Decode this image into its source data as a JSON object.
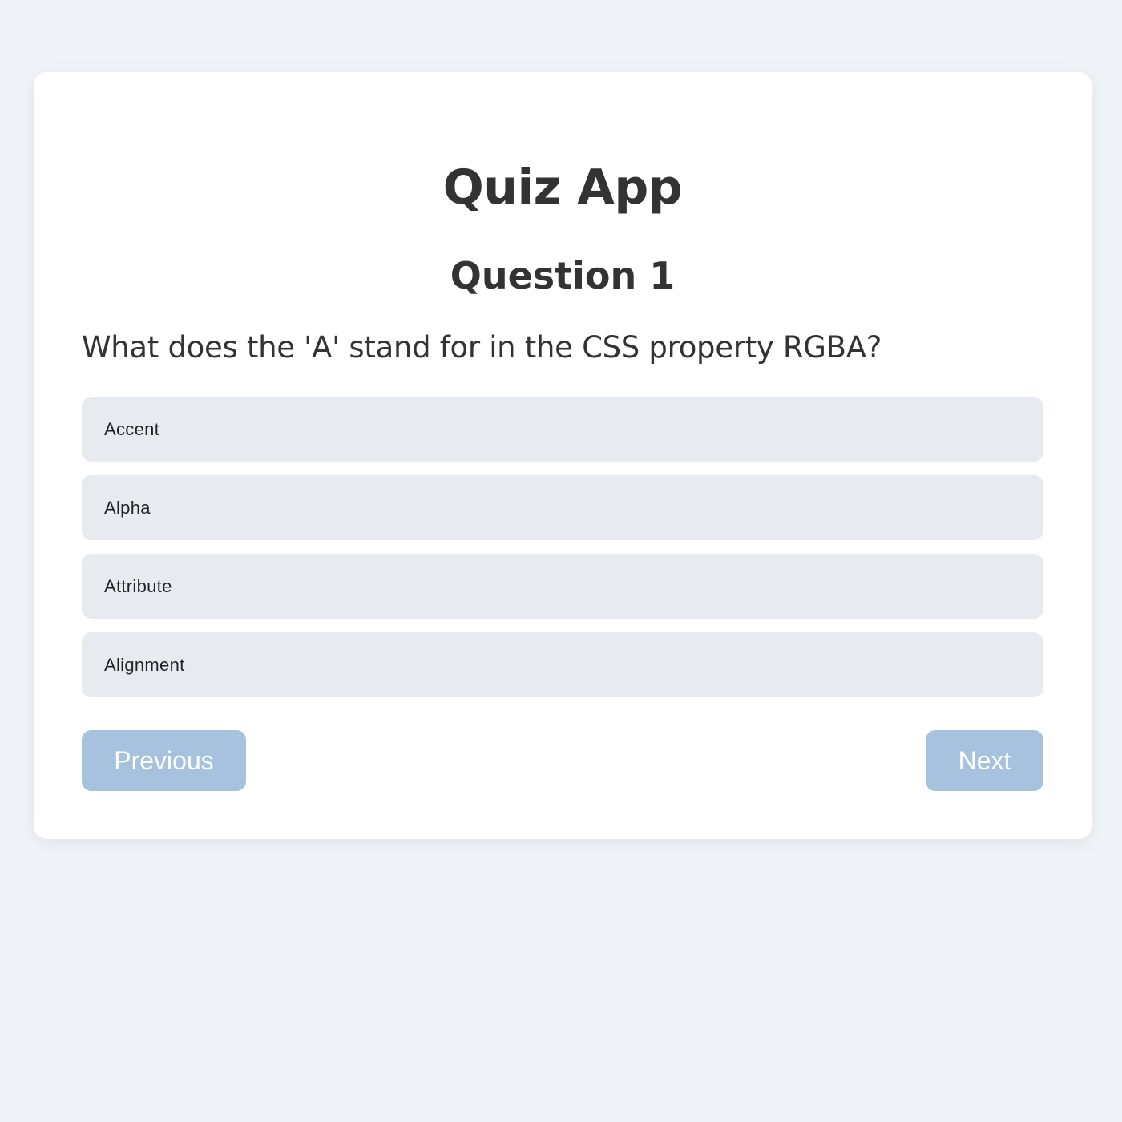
{
  "app": {
    "title": "Quiz App"
  },
  "question": {
    "number_label": "Question 1",
    "text": "What does the 'A' stand for in the CSS property RGBA?",
    "options": [
      {
        "label": "Accent"
      },
      {
        "label": "Alpha"
      },
      {
        "label": "Attribute"
      },
      {
        "label": "Alignment"
      }
    ]
  },
  "navigation": {
    "previous_label": "Previous",
    "next_label": "Next"
  },
  "colors": {
    "page_background": "#f0f3f8",
    "card_background": "#ffffff",
    "option_background": "#e7eaef",
    "button_background": "#a7c2df",
    "text": "#333333"
  }
}
